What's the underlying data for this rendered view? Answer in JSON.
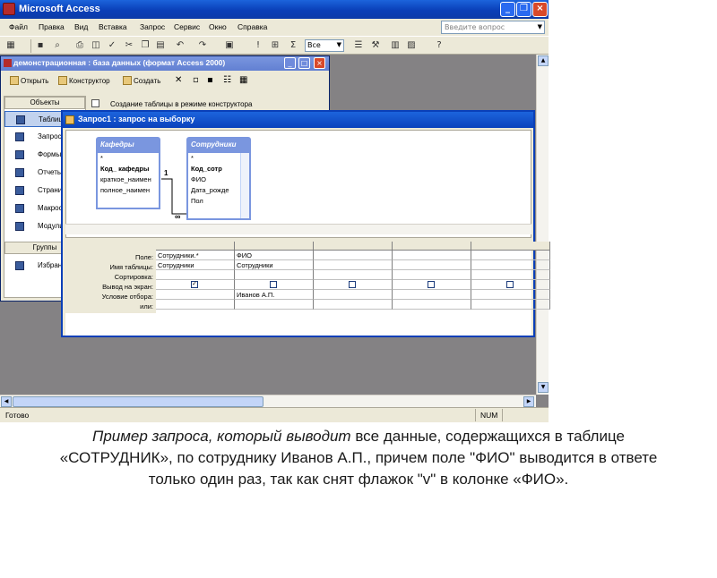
{
  "app": {
    "title": "Microsoft Access"
  },
  "menu": [
    "Файл",
    "Правка",
    "Вид",
    "Вставка",
    "Запрос",
    "Сервис",
    "Окно",
    "Справка"
  ],
  "ask_placeholder": "Введите вопрос",
  "toolbar": {
    "combo_value": "Все"
  },
  "status": {
    "left": "Готово",
    "num": "NUM"
  },
  "db_window": {
    "title": "демонстрационная : база данных (формат Access 2000)",
    "buttons": {
      "open": "Открыть",
      "design": "Конструктор",
      "create": "Создать"
    },
    "objects_header": "Объекты",
    "groups_header": "Группы",
    "objects": [
      "Таблицы",
      "Запросы",
      "Формы",
      "Отчеты",
      "Страницы",
      "Макросы",
      "Модули"
    ],
    "favorites": "Избранное",
    "create_row": "Создание таблицы в режиме конструктора"
  },
  "query_window": {
    "title": "Запрос1 : запрос на выборку",
    "tables": [
      {
        "name": "Кафедры",
        "fields": [
          "*",
          "Код_ кафедры",
          "краткое_наимен",
          "полное_наимен"
        ]
      },
      {
        "name": "Сотрудники",
        "fields": [
          "*",
          "Код_сотр",
          "ФИО",
          "Дата_рожде",
          "Пол"
        ]
      }
    ],
    "relation": {
      "one": "1",
      "many": "∞"
    },
    "grid": {
      "row_labels": [
        "Поле:",
        "Имя таблицы:",
        "Сортировка:",
        "Вывод на экран:",
        "Условие отбора:",
        "или:"
      ],
      "columns": [
        {
          "field": "Сотрудники.*",
          "table": "Сотрудники",
          "sort": "",
          "show": true,
          "criteria": "",
          "or": ""
        },
        {
          "field": "ФИО",
          "table": "Сотрудники",
          "sort": "",
          "show": false,
          "criteria": "Иванов А.П.",
          "or": ""
        },
        {
          "field": "",
          "table": "",
          "sort": "",
          "show": false,
          "criteria": "",
          "or": ""
        },
        {
          "field": "",
          "table": "",
          "sort": "",
          "show": false,
          "criteria": "",
          "or": ""
        },
        {
          "field": "",
          "table": "",
          "sort": "",
          "show": false,
          "criteria": "",
          "or": ""
        }
      ]
    }
  },
  "caption": {
    "italic_part": "Пример запроса, который выводит",
    "rest": " все данные, содержащихся в таблице «СОТРУДНИК», по сотруднику Иванов А.П., причем поле \"ФИО\" выводится в ответе только один раз, так как снят флажок \"v\" в колонке «ФИО»."
  }
}
